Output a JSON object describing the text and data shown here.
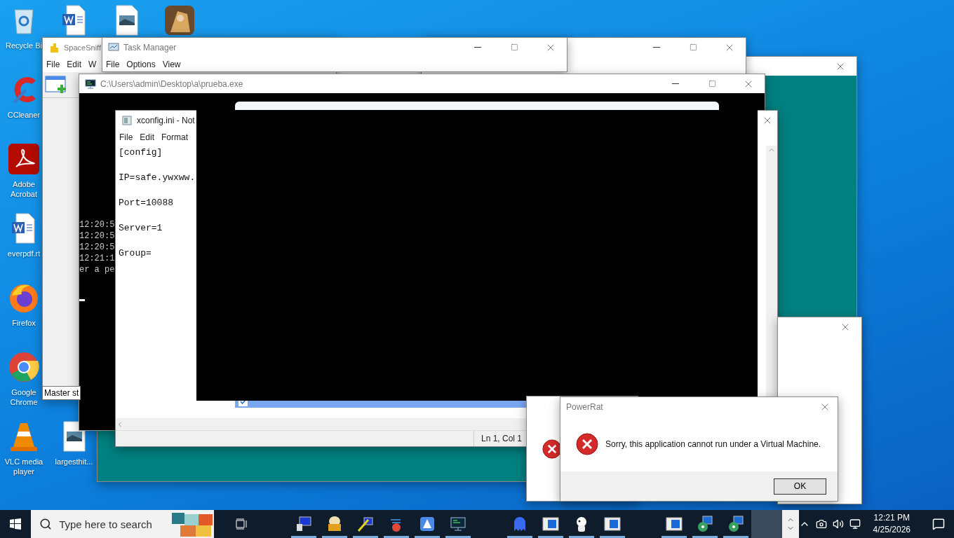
{
  "desktop_icons": [
    {
      "kind": "recycle",
      "label": "Recycle Bi"
    },
    {
      "kind": "word"
    },
    {
      "kind": "image"
    },
    {
      "kind": "game"
    },
    {
      "kind": "ccleaner",
      "label": "CCleaner"
    },
    {
      "kind": "acrobat",
      "label": "Adobe Acrobat"
    },
    {
      "kind": "word",
      "label": "everpdf.rt"
    },
    {
      "kind": "firefox",
      "label": "Firefox"
    },
    {
      "kind": "chrome",
      "label": "Google Chrome"
    },
    {
      "kind": "vlc",
      "label": "VLC media player"
    },
    {
      "kind": "image",
      "label": "largesthit..."
    }
  ],
  "spacesniffer": {
    "title": "SpaceSniff",
    "menu": [
      "File",
      "Edit",
      "W"
    ],
    "tooltip": "Master st"
  },
  "task_manager": {
    "title": "Task Manager",
    "menu": [
      "File",
      "Options",
      "View"
    ]
  },
  "console": {
    "title": "C:\\Users\\admin\\Desktop\\a\\prueba.exe",
    "lines": [
      "12:20:5",
      "12:20:5",
      "12:20:5",
      "12:21:1",
      "er a pe"
    ]
  },
  "notepad": {
    "title": "xconfig.ini - Not",
    "menu": [
      "File",
      "Edit",
      "Format"
    ],
    "lines": [
      "[config]",
      "IP=safe.ywxww.",
      "Port=10088",
      "Server=1",
      "Group="
    ],
    "status": "Ln 1, Col 1"
  },
  "installer": {
    "agreement_checked": true
  },
  "dialog": {
    "title": "PowerRat",
    "message": "Sorry, this application cannot run under a Virtual Machine.",
    "button": "OK"
  },
  "taskbar": {
    "search_placeholder": "Type here to search",
    "apps": [
      {
        "kind": "computer",
        "running": true
      },
      {
        "kind": "bag",
        "running": true
      },
      {
        "kind": "tools",
        "running": true
      },
      {
        "kind": "swirl",
        "running": true
      },
      {
        "kind": "sail",
        "running": true
      },
      {
        "kind": "terminal",
        "running": true
      },
      {
        "kind": "ghost",
        "running": true
      },
      {
        "kind": "window",
        "running": true
      },
      {
        "kind": "dog",
        "running": true
      },
      {
        "kind": "window",
        "running": true
      },
      {
        "kind": "window",
        "running": true
      },
      {
        "kind": "installer",
        "running": true
      },
      {
        "kind": "installer",
        "running": true
      }
    ],
    "time": "12:21 PM",
    "date": "4/25/2026"
  }
}
